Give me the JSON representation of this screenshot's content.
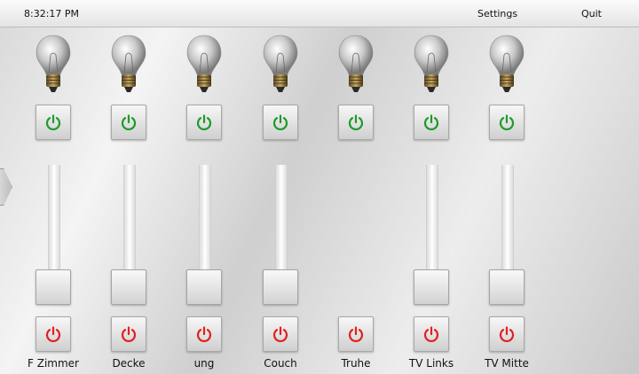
{
  "topbar": {
    "clock": "8:32:17 PM",
    "settings_label": "Settings",
    "quit_label": "Quit"
  },
  "colors": {
    "power_on": "#1e9a2a",
    "power_off": "#e02020"
  },
  "channels": [
    {
      "label": "F Zimmer",
      "has_slider": true
    },
    {
      "label": "Decke",
      "has_slider": true
    },
    {
      "label": "ung",
      "has_slider": true
    },
    {
      "label": "Couch",
      "has_slider": true
    },
    {
      "label": "Truhe",
      "has_slider": false
    },
    {
      "label": "TV Links",
      "has_slider": true
    },
    {
      "label": "TV Mitte",
      "has_slider": true
    }
  ]
}
